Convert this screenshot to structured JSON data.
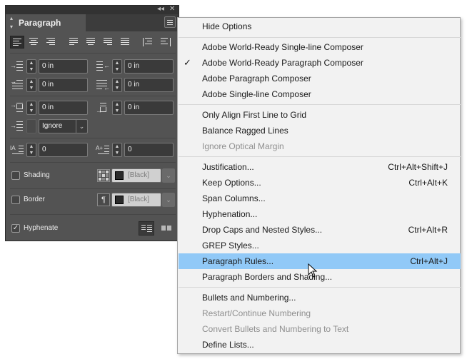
{
  "panel": {
    "tab_label": "Paragraph",
    "fields": {
      "left_indent": "0 in",
      "right_indent": "0 in",
      "first_line_indent": "0 in",
      "last_line_indent": "0 in",
      "space_before": "0 in",
      "space_after": "0 in",
      "align_to_grid": "Ignore",
      "drop_cap_lines": "0",
      "drop_cap_chars": "0"
    },
    "shading": {
      "label": "Shading",
      "checked": false,
      "swatch": "[Black]"
    },
    "border": {
      "label": "Border",
      "checked": false,
      "swatch": "[Black]"
    },
    "hyphenate": {
      "label": "Hyphenate",
      "checked": true
    }
  },
  "menu": {
    "items": [
      {
        "label": "Hide Options",
        "shortcut": ""
      },
      {
        "label": "Adobe World-Ready Single-line Composer",
        "shortcut": ""
      },
      {
        "label": "Adobe World-Ready Paragraph Composer",
        "shortcut": "",
        "checked": true
      },
      {
        "label": "Adobe Paragraph Composer",
        "shortcut": ""
      },
      {
        "label": "Adobe Single-line Composer",
        "shortcut": ""
      },
      {
        "label": "Only Align First Line to Grid",
        "shortcut": ""
      },
      {
        "label": "Balance Ragged Lines",
        "shortcut": ""
      },
      {
        "label": "Ignore Optical Margin",
        "shortcut": "",
        "disabled": true
      },
      {
        "label": "Justification...",
        "shortcut": "Ctrl+Alt+Shift+J"
      },
      {
        "label": "Keep Options...",
        "shortcut": "Ctrl+Alt+K"
      },
      {
        "label": "Span Columns...",
        "shortcut": ""
      },
      {
        "label": "Hyphenation...",
        "shortcut": ""
      },
      {
        "label": "Drop Caps and Nested Styles...",
        "shortcut": "Ctrl+Alt+R"
      },
      {
        "label": "GREP Styles...",
        "shortcut": ""
      },
      {
        "label": "Paragraph Rules...",
        "shortcut": "Ctrl+Alt+J",
        "highlighted": true
      },
      {
        "label": "Paragraph Borders and Shading...",
        "shortcut": ""
      },
      {
        "label": "Bullets and Numbering...",
        "shortcut": ""
      },
      {
        "label": "Restart/Continue Numbering",
        "shortcut": "",
        "disabled": true
      },
      {
        "label": "Convert Bullets and Numbering to Text",
        "shortcut": "",
        "disabled": true
      },
      {
        "label": "Define Lists...",
        "shortcut": ""
      }
    ]
  },
  "colors": {
    "panel_bg": "#535353",
    "menu_bg": "#f2f2f2",
    "menu_highlight": "#91c9f7",
    "disabled_text": "#8f8f8f"
  }
}
